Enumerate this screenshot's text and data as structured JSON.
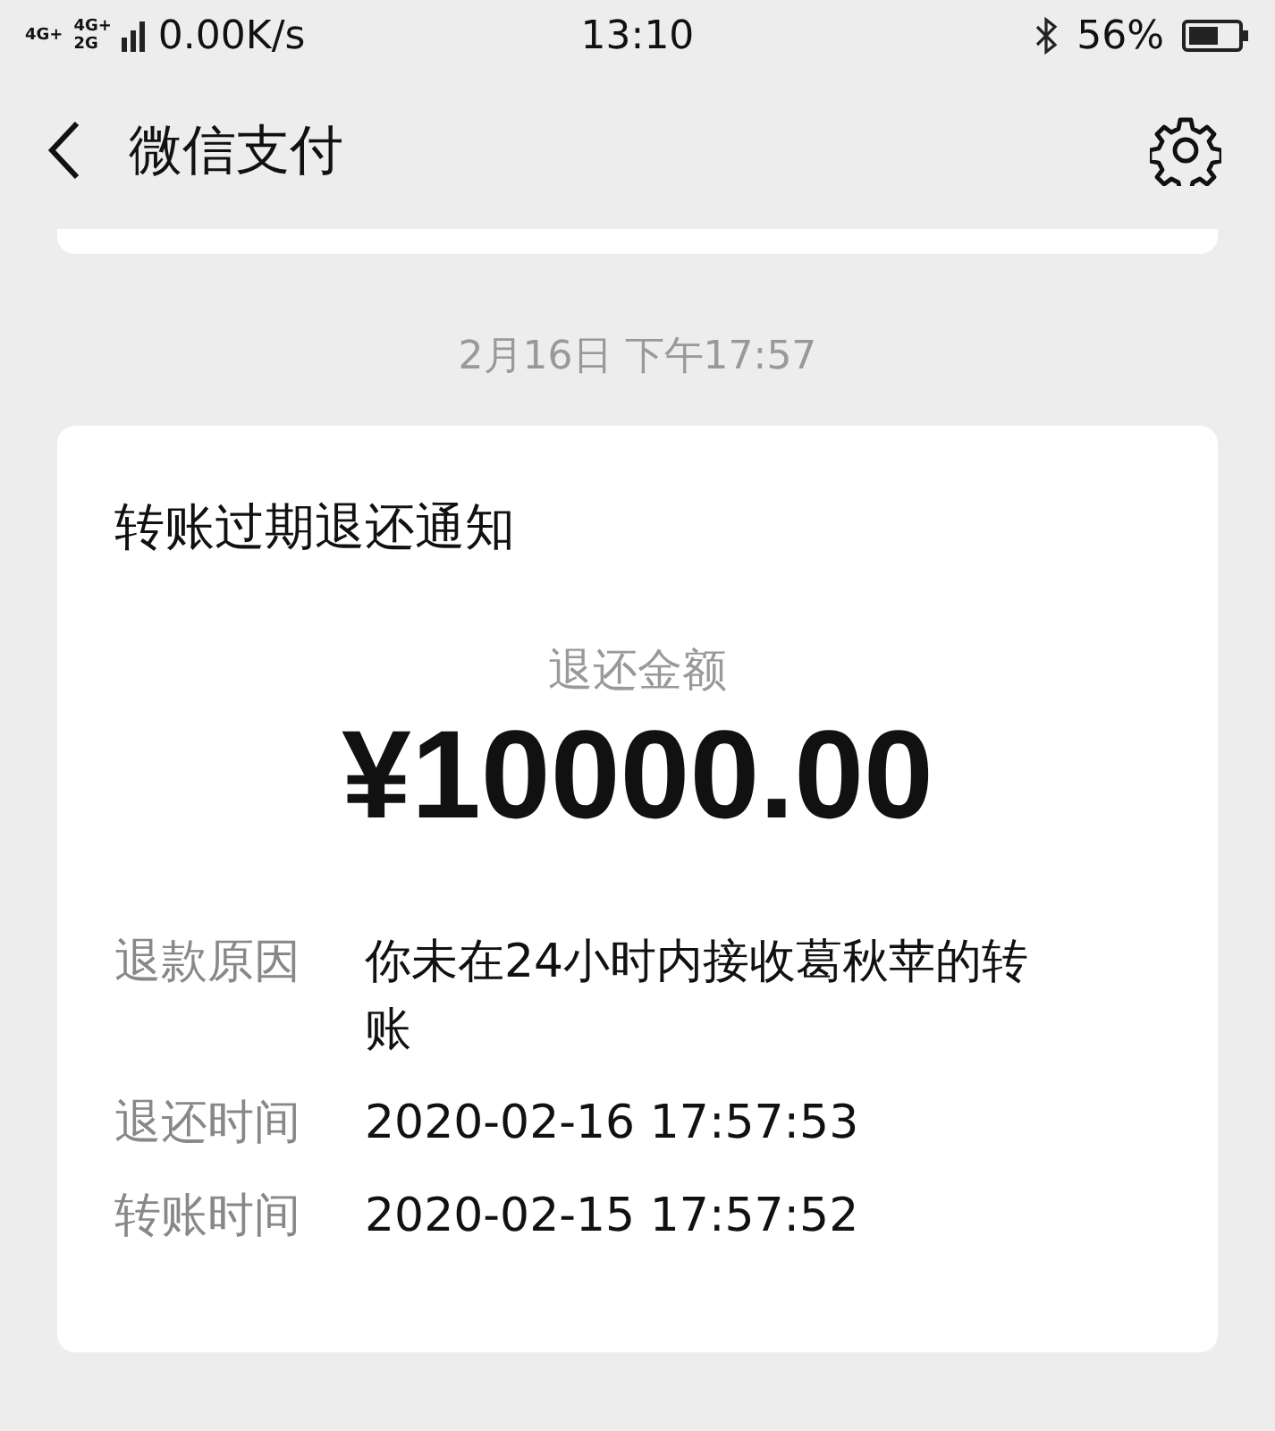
{
  "status_bar": {
    "network_labels": [
      "4G+",
      "4G+",
      "2G"
    ],
    "speed": "0.00K/s",
    "time": "13:10",
    "battery_percent": "56%"
  },
  "nav": {
    "title": "微信支付"
  },
  "timestamp": "2月16日 下午17:57",
  "card": {
    "title": "转账过期退还通知",
    "amount_label": "退还金额",
    "amount": "¥10000.00",
    "rows": [
      {
        "label": "退款原因",
        "value": "你未在24小时内接收葛秋苹的转账"
      },
      {
        "label": "退还时间",
        "value": "2020-02-16 17:57:53"
      },
      {
        "label": "转账时间",
        "value": "2020-02-15 17:57:52"
      }
    ]
  }
}
